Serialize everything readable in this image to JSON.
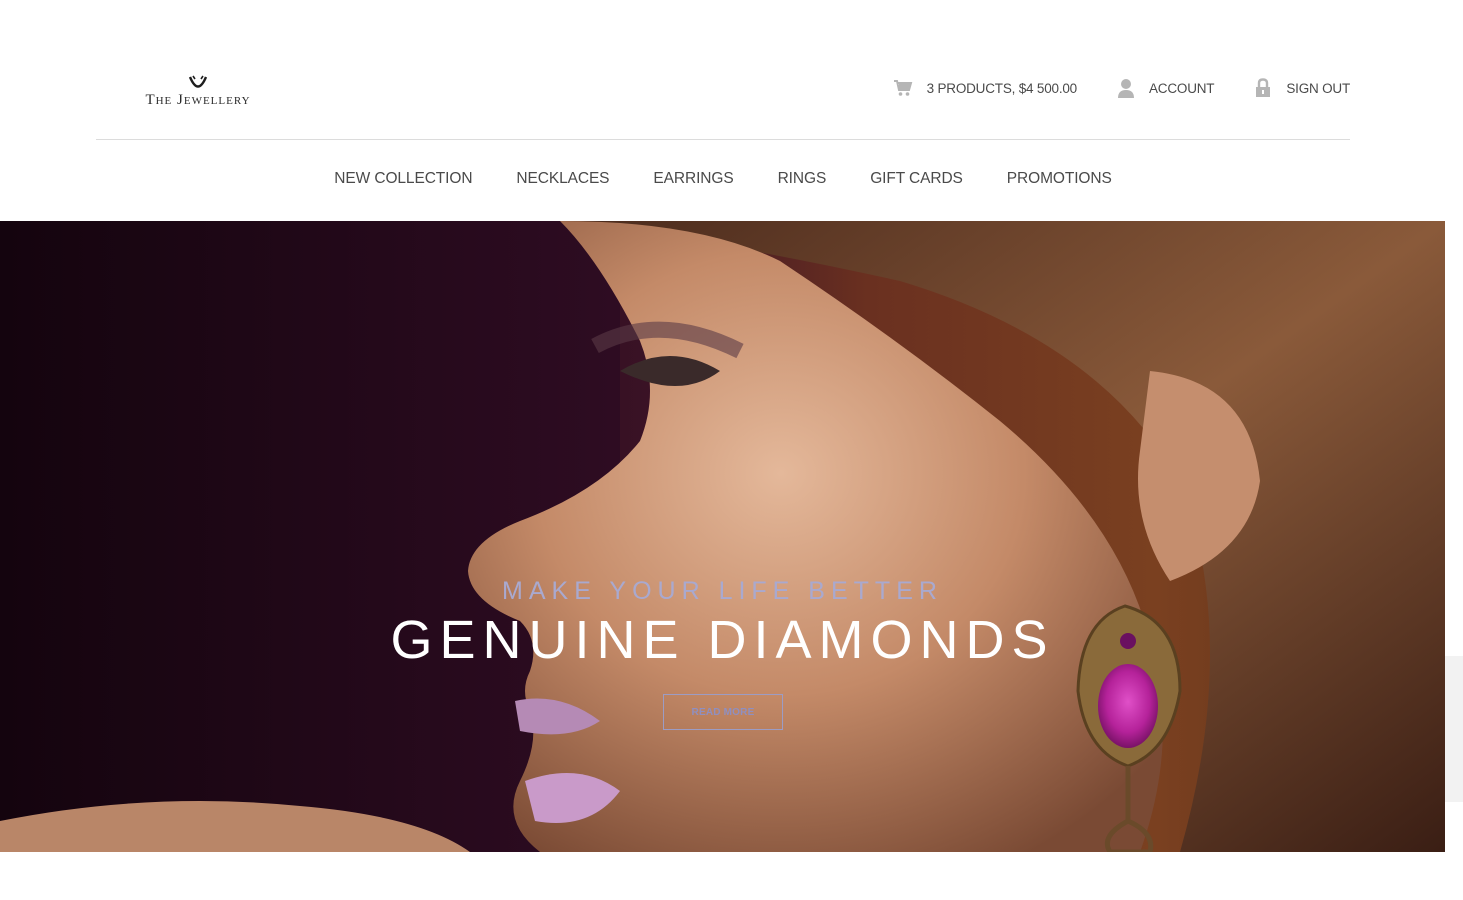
{
  "brand": {
    "name": "The Jewellery",
    "logo_icon": "ring-logo-icon"
  },
  "topbar": {
    "cart": {
      "icon": "cart-icon",
      "label": "3 PRODUCTS, $4 500.00"
    },
    "account": {
      "icon": "user-icon",
      "label": "ACCOUNT"
    },
    "signout": {
      "icon": "lock-icon",
      "label": "SIGN OUT"
    }
  },
  "nav": {
    "items": [
      {
        "label": "NEW COLLECTION"
      },
      {
        "label": "NECKLACES"
      },
      {
        "label": "EARRINGS"
      },
      {
        "label": "RINGS"
      },
      {
        "label": "GIFT CARDS"
      },
      {
        "label": "PROMOTIONS"
      }
    ]
  },
  "hero": {
    "subtitle": "MAKE YOUR LIFE BETTER",
    "title": "GENUINE DIAMONDS",
    "button_label": "READ MORE"
  },
  "colors": {
    "text": "#4a4a4a",
    "accent": "#a9a9cf",
    "hero_bg": "#2a0b20",
    "gem": "#b5229a"
  }
}
